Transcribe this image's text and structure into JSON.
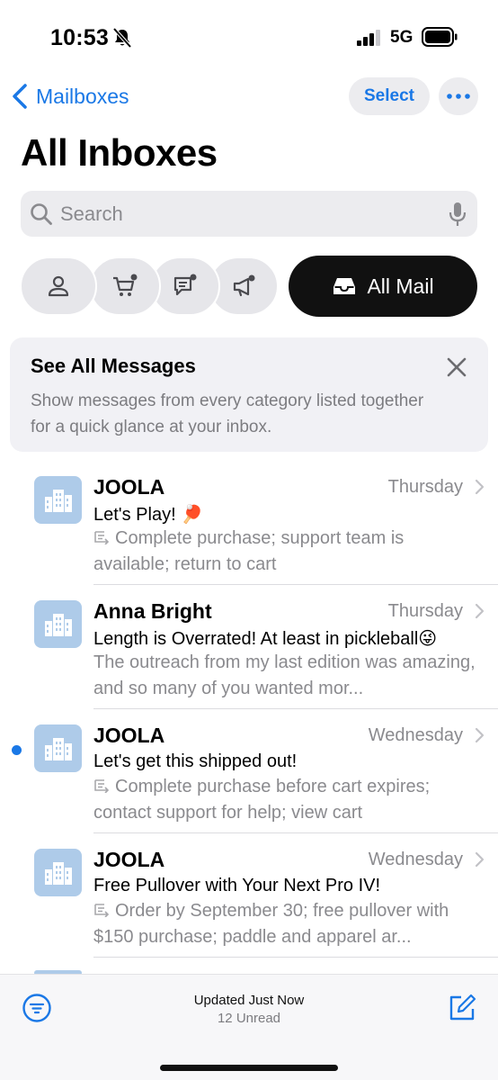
{
  "status_bar": {
    "time": "10:53",
    "network": "5G"
  },
  "nav": {
    "back_label": "Mailboxes",
    "select_label": "Select"
  },
  "page_title": "All Inboxes",
  "search": {
    "placeholder": "Search"
  },
  "categories": {
    "items": [
      "person-icon",
      "shopping-cart-icon",
      "chat-bubble-icon",
      "megaphone-icon"
    ],
    "selected_label": "All Mail"
  },
  "info_card": {
    "title": "See All Messages",
    "description": "Show messages from every category listed together for a quick glance at your inbox."
  },
  "messages": [
    {
      "sender": "JOOLA",
      "date": "Thursday",
      "subject": "Let's Play! 🏓",
      "preview": "Complete purchase; support team is available; return to cart",
      "summary": true,
      "unread": false
    },
    {
      "sender": "Anna Bright",
      "date": "Thursday",
      "subject": "Length is Overrated! At least in pickleball😜",
      "preview": "The outreach from my last edition was amazing, and so many of you wanted mor...",
      "summary": false,
      "unread": false
    },
    {
      "sender": "JOOLA",
      "date": "Wednesday",
      "subject": "Let's get this shipped out!",
      "preview": "Complete purchase before cart expires; contact support for help; view cart",
      "summary": true,
      "unread": true
    },
    {
      "sender": "JOOLA",
      "date": "Wednesday",
      "subject": "Free Pullover with Your Next Pro IV!",
      "preview": "Order by September 30; free pullover with $150 purchase; paddle and apparel ar...",
      "summary": true,
      "unread": false
    }
  ],
  "bottom_bar": {
    "status": "Updated Just Now",
    "unread": "12 Unread"
  },
  "colors": {
    "accent": "#1a78e6",
    "avatar": "#aecbe9",
    "secondary_text": "#8a8a8e"
  }
}
